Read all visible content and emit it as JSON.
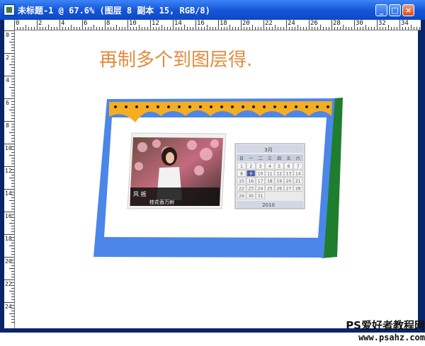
{
  "window": {
    "title": "未标题-1 @ 67.6% (图层 8 副本 15, RGB/8)",
    "min_label": "_",
    "max_label": "□",
    "close_label": "×"
  },
  "ruler_top_labels": [
    "0",
    "2",
    "4",
    "6",
    "8",
    "10",
    "12",
    "14",
    "16",
    "18",
    "20",
    "22",
    "24",
    "26",
    "28",
    "30",
    "32",
    "34"
  ],
  "ruler_left_labels": [
    "0",
    "2",
    "4",
    "6",
    "8",
    "10",
    "12",
    "14",
    "16",
    "18",
    "20",
    "22",
    "24"
  ],
  "canvas": {
    "headline": "再制多个到图层得."
  },
  "calendar": {
    "photo_caption_1": "风 摇",
    "photo_caption_2": "桂花香万树",
    "month_header": "3月",
    "weekday_header": [
      "日",
      "一",
      "二",
      "三",
      "四",
      "五",
      "六"
    ],
    "dates": [
      "1",
      "2",
      "3",
      "4",
      "5",
      "6",
      "7",
      "8",
      "9",
      "10",
      "11",
      "12",
      "13",
      "14",
      "15",
      "16",
      "17",
      "18",
      "19",
      "20",
      "21",
      "22",
      "23",
      "24",
      "25",
      "26",
      "27",
      "28",
      "29",
      "30",
      "31"
    ],
    "highlighted_date": "9",
    "year": "2010"
  },
  "watermark": {
    "line1": "PS爱好者教程网",
    "line2": "www.psahz.com"
  },
  "colors": {
    "title_gradient_top": "#3d84f7",
    "headline": "#e38b3d",
    "calendar_blue": "#4c86e8",
    "calendar_orange": "#f5ad22",
    "calendar_green": "#1f7d2e"
  }
}
